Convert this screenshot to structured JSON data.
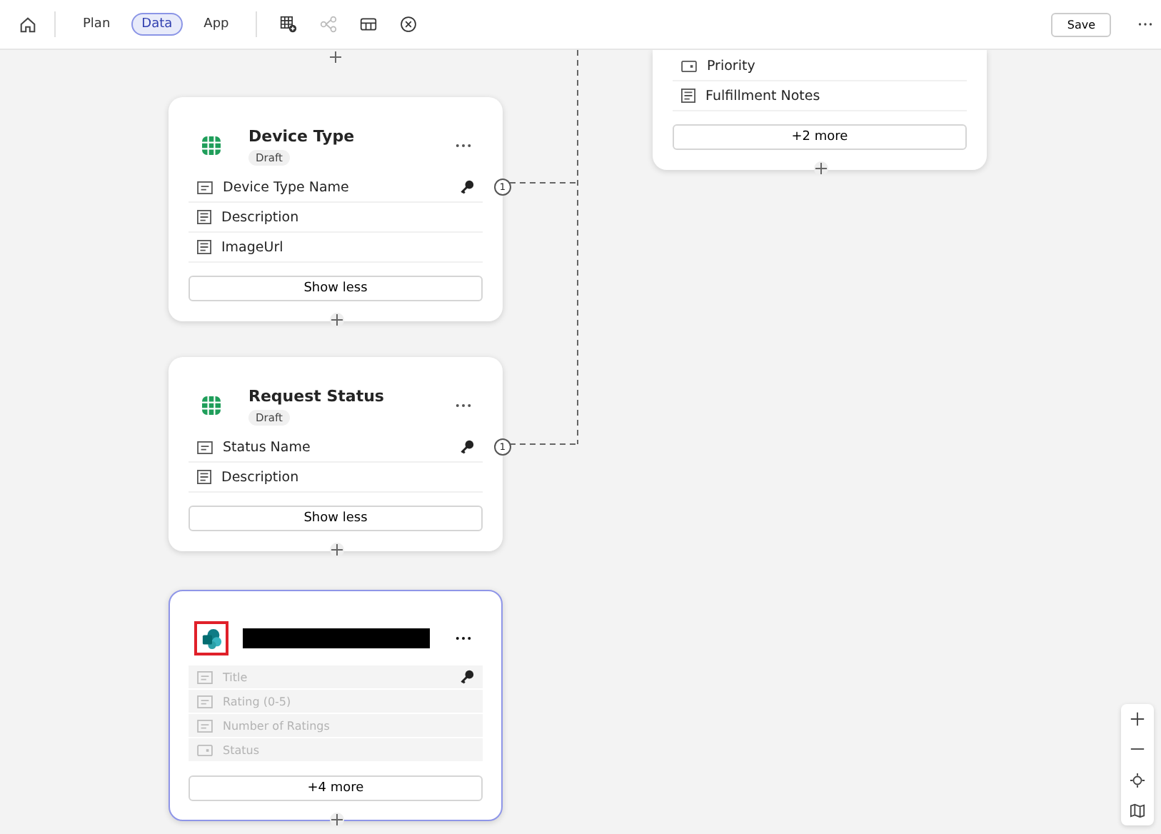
{
  "toolbar": {
    "tabs": [
      {
        "label": "Plan",
        "selected": false
      },
      {
        "label": "Data",
        "selected": true
      },
      {
        "label": "App",
        "selected": false
      }
    ],
    "tools": [
      {
        "kind": "add-table",
        "disabled": false
      },
      {
        "kind": "relationship",
        "disabled": true
      },
      {
        "kind": "view",
        "disabled": false
      },
      {
        "kind": "close",
        "disabled": false
      }
    ],
    "save": "Save"
  },
  "cards": [
    {
      "kind": "table",
      "title": "Device Type",
      "status": "Draft",
      "selected": false,
      "fields": [
        {
          "kind": "text",
          "name": "Device Type Name",
          "key": true,
          "relation": "1"
        },
        {
          "kind": "multiline",
          "name": "Description",
          "key": false
        },
        {
          "kind": "multiline",
          "name": "ImageUrl",
          "key": false
        }
      ],
      "button": "Show less"
    },
    {
      "kind": "table",
      "title": "Request Status",
      "status": "Draft",
      "selected": false,
      "fields": [
        {
          "kind": "text",
          "name": "Status Name",
          "key": true,
          "relation": "1"
        },
        {
          "kind": "multiline",
          "name": "Description",
          "key": false
        }
      ],
      "button": "Show less"
    },
    {
      "kind": "list",
      "selected": true,
      "highlighted": true,
      "redacted": true,
      "blurred": true,
      "fields": [
        {
          "kind": "text",
          "name": "Title",
          "key": true
        },
        {
          "kind": "text",
          "name": "Rating (0-5)",
          "key": false
        },
        {
          "kind": "text",
          "name": "Number of Ratings",
          "key": false
        },
        {
          "kind": "choice",
          "name": "Status",
          "key": false
        }
      ],
      "button": "+4 more"
    },
    {
      "kind": "cut",
      "selected": false,
      "fields": [
        {
          "kind": "choice",
          "name": "Priority",
          "key": false
        },
        {
          "kind": "multiline",
          "name": "Fulfillment Notes",
          "key": false
        }
      ],
      "button": "+2 more"
    }
  ]
}
